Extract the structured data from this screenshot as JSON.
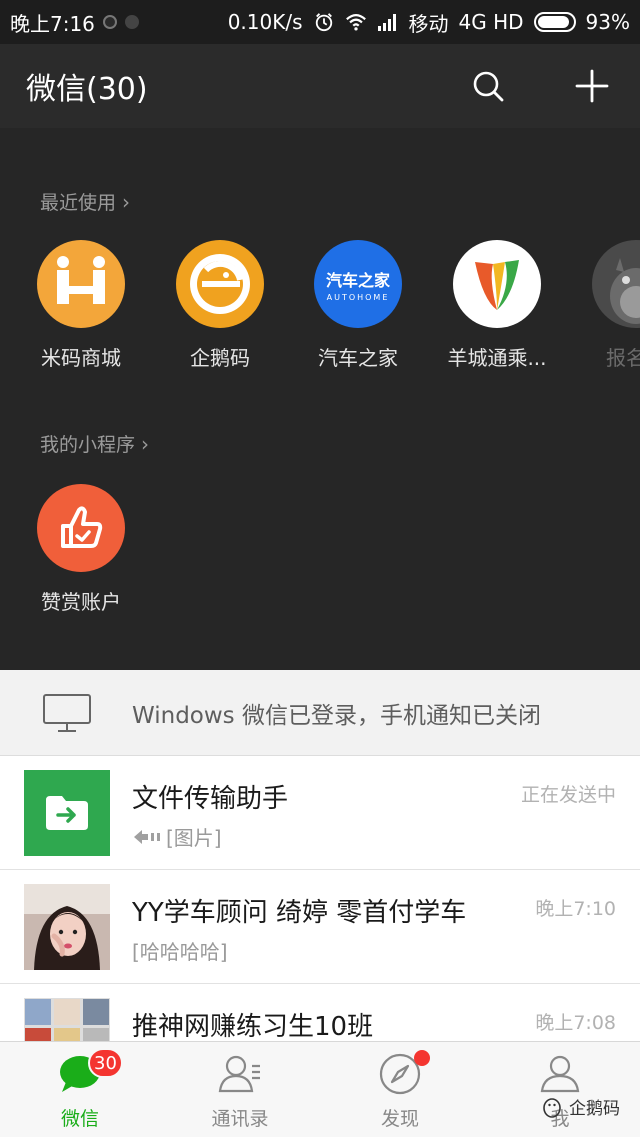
{
  "status_bar": {
    "time": "晚上7:16",
    "speed": "0.10K/s",
    "carrier": "移动",
    "network": "4G HD",
    "battery_percent": "93%",
    "battery_level": 0.93
  },
  "header": {
    "title": "微信(30)",
    "search_icon": "search-icon",
    "add_icon": "plus-icon"
  },
  "drawer": {
    "recent_label": "最近使用",
    "recent_apps": [
      {
        "label": "米码商城",
        "icon": "mima-mall-icon"
      },
      {
        "label": "企鹅码",
        "icon": "qiema-icon"
      },
      {
        "label": "汽车之家",
        "icon": "autohome-icon",
        "logo_text": "汽车之家",
        "logo_sub": "AUTOHOME"
      },
      {
        "label": "羊城通乘...",
        "icon": "yangchengtong-icon"
      },
      {
        "label": "报名去",
        "icon": "totoro-icon"
      }
    ],
    "my_label": "我的小程序",
    "my_apps": [
      {
        "label": "赞赏账户",
        "icon": "thumbs-up-icon"
      }
    ]
  },
  "banner": {
    "icon": "monitor-icon",
    "text": "Windows 微信已登录，手机通知已关闭"
  },
  "chats": [
    {
      "name": "文件传输助手",
      "preview": "[图片]",
      "time": "正在发送中",
      "avatar": "file-transfer-icon"
    },
    {
      "name": "YY学车顾问  绮婷 零首付学车",
      "preview": "[哈哈哈哈]",
      "time": "晚上7:10",
      "avatar": "user-photo"
    },
    {
      "name": "推神网赚练习生10班",
      "preview": "",
      "time": "晚上7:08",
      "avatar": "group-photo"
    }
  ],
  "tabs": [
    {
      "label": "微信",
      "icon": "chat-bubble-icon",
      "badge": "30"
    },
    {
      "label": "通讯录",
      "icon": "contacts-icon"
    },
    {
      "label": "发现",
      "icon": "compass-icon"
    },
    {
      "label": "我",
      "icon": "profile-icon"
    }
  ],
  "watermark": "企鹅码",
  "colors": {
    "accent_green": "#1aad19",
    "badge_red": "#f43530",
    "header_bg": "#2b2b2b",
    "drawer_bg": "#262626"
  }
}
